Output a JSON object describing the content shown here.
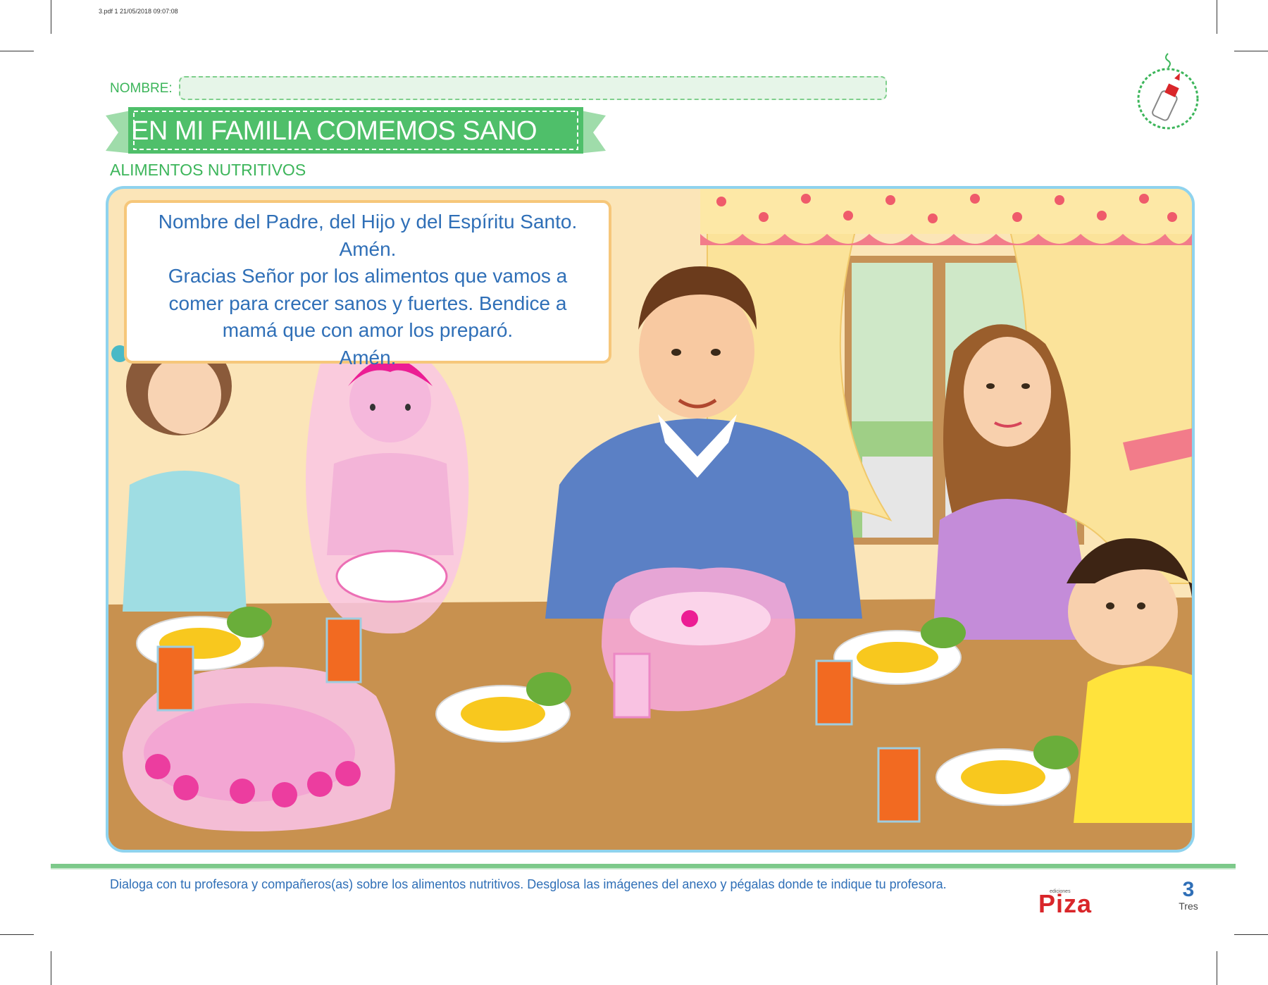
{
  "file_info": "3.pdf   1   21/05/2018   09:07:08",
  "header": {
    "name_label": "NOMBRE:",
    "title": "EN MI FAMILIA COMEMOS SANO",
    "subtitle": "ALIMENTOS NUTRITIVOS"
  },
  "prayer": {
    "lines": [
      "Nombre del Padre, del Hijo y del Espíritu Santo.",
      "Amén.",
      "Gracias Señor por los alimentos que vamos a",
      "comer para crecer sanos y fuertes. Bendice a",
      "mamá que con amor los preparó.",
      "Amén."
    ]
  },
  "footer": {
    "instruction": "Dialoga con tu profesora y compañeros(as) sobre los alimentos nutritivos. Desglosa las imágenes del anexo y pégalas donde te indique tu profesora.",
    "logo_small": "ediciones",
    "logo": "Piza",
    "page_number": "3",
    "page_word": "Tres"
  },
  "colors": {
    "green": "#3cb55a",
    "banner": "#4fbf6a",
    "blue_text": "#2f6fb7",
    "scene_border": "#8fd3ee",
    "table": "#c8914f",
    "wall": "#fbe5b8",
    "highlight_pink": "#f3a6d3",
    "logo_red": "#d9262a"
  },
  "icons": {
    "glue_badge": "glue-bottle-icon"
  }
}
